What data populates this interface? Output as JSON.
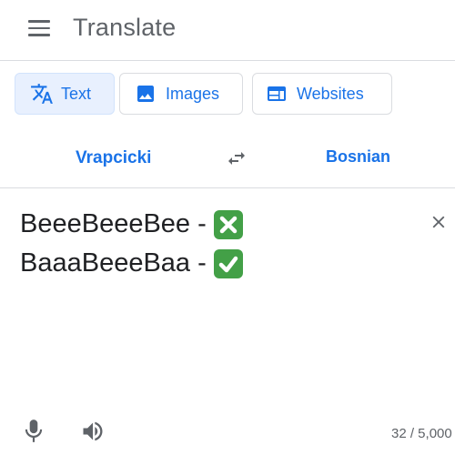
{
  "header": {
    "title": "Translate",
    "menu_icon": "hamburger-menu-icon"
  },
  "modes": [
    {
      "label": "Text",
      "icon": "translate-icon",
      "active": true
    },
    {
      "label": "Images",
      "icon": "image-icon",
      "active": false
    },
    {
      "label": "Websites",
      "icon": "web-icon",
      "active": false
    }
  ],
  "languages": {
    "source": "Vrapcicki",
    "target": "Bosnian",
    "swap_icon": "swap-arrows-icon"
  },
  "input": {
    "lines": [
      {
        "text": "BeeeBeeeBee - ",
        "emoji": "❎",
        "emoji_name": "cross-mark-icon"
      },
      {
        "text": "BaaaBeeeBaa - ",
        "emoji": "✅",
        "emoji_name": "check-mark-icon"
      }
    ],
    "clear_icon": "close-icon",
    "char_count": "32 / 5,000"
  },
  "footer": {
    "mic_icon": "microphone-icon",
    "speaker_icon": "speaker-icon"
  },
  "colors": {
    "accent": "#1a73e8",
    "active_bg": "#e8f0fe",
    "emoji_bg": "#43a047",
    "divider": "#dadce0"
  }
}
